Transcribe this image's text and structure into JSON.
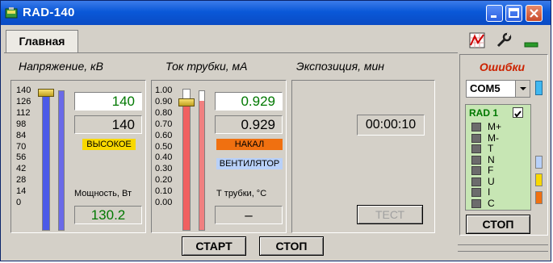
{
  "window": {
    "title": "RAD-140"
  },
  "tabs": [
    {
      "label": "Главная"
    }
  ],
  "voltage": {
    "header": "Напряжение, кВ",
    "scale": [
      "140",
      "126",
      "112",
      "98",
      "84",
      "70",
      "56",
      "42",
      "28",
      "14",
      "0"
    ],
    "set_value": "140",
    "actual_value": "140",
    "badge": "ВЫСОКОЕ",
    "power_label": "Мощность, Вт",
    "power_value": "130.2",
    "slider_level": 1.0,
    "bar_level": 1.0
  },
  "current": {
    "header": "Ток трубки, мА",
    "scale": [
      "1.00",
      "0.90",
      "0.80",
      "0.70",
      "0.60",
      "0.50",
      "0.40",
      "0.30",
      "0.20",
      "0.10",
      "0.00"
    ],
    "set_value": "0.929",
    "actual_value": "0.929",
    "badge_filament": "НАКАЛ",
    "badge_fan": "ВЕНТИЛЯТОР",
    "temp_label": "Т трубки, °С",
    "temp_value": "–",
    "slider_level": 0.929,
    "bar_level": 0.929
  },
  "exposure": {
    "header": "Экспозиция, мин",
    "time": "00:00:10",
    "test_button": "ТЕСТ"
  },
  "errors": {
    "header": "Ошибки",
    "port": "COM5",
    "device": "RAD 1",
    "device_checked": true,
    "flags": [
      "M+",
      "M-",
      "T",
      "N",
      "F",
      "U",
      "I",
      "C"
    ],
    "stop_button": "СТОП"
  },
  "footer": {
    "start_button": "СТАРТ",
    "stop_button": "СТОП"
  },
  "colors": {
    "voltage_header": "#1840c0",
    "current_header": "#cc2200",
    "voltage_bar": "#4a5ae8",
    "current_bar": "#f06060",
    "value_green": "#007800",
    "badge_yellow": "#f8d800",
    "badge_orange": "#f07010",
    "badge_blue": "#b8d0f8"
  }
}
